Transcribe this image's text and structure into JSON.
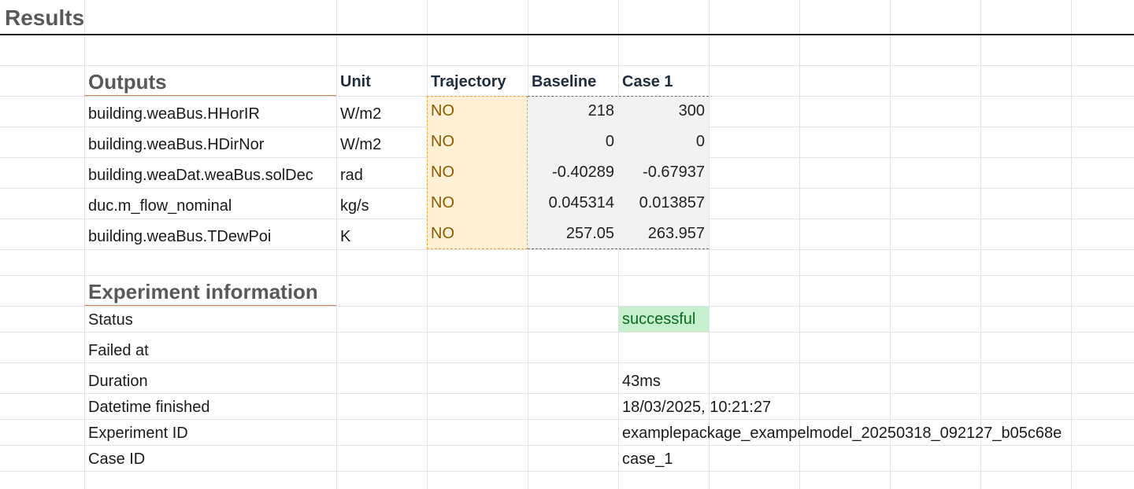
{
  "sheet": {
    "title": "Results"
  },
  "outputs": {
    "section_title": "Outputs",
    "headers": {
      "unit": "Unit",
      "trajectory": "Trajectory",
      "baseline": "Baseline",
      "case1": "Case 1"
    },
    "rows": [
      {
        "name": "building.weaBus.HHorIR",
        "unit": "W/m2",
        "trajectory": "NO",
        "baseline": "218",
        "case1": "300"
      },
      {
        "name": "building.weaBus.HDirNor",
        "unit": "W/m2",
        "trajectory": "NO",
        "baseline": "0",
        "case1": "0"
      },
      {
        "name": "building.weaDat.weaBus.solDec",
        "unit": "rad",
        "trajectory": "NO",
        "baseline": "-0.40289",
        "case1": "-0.67937"
      },
      {
        "name": "duc.m_flow_nominal",
        "unit": "kg/s",
        "trajectory": "NO",
        "baseline": "0.045314",
        "case1": "0.013857"
      },
      {
        "name": "building.weaBus.TDewPoi",
        "unit": "K",
        "trajectory": "NO",
        "baseline": "257.05",
        "case1": "263.957"
      }
    ]
  },
  "experiment": {
    "section_title": "Experiment information",
    "rows": [
      {
        "label": "Status",
        "value": "successful"
      },
      {
        "label": "Failed at",
        "value": ""
      },
      {
        "label": "Duration",
        "value": "43ms"
      },
      {
        "label": "Datetime finished",
        "value": "18/03/2025, 10:21:27"
      },
      {
        "label": "Experiment ID",
        "value": "examplepackage_exampelmodel_20250318_092127_b05c68e"
      },
      {
        "label": "Case ID",
        "value": "case_1"
      }
    ]
  },
  "colors": {
    "trajectory_fill": "#fff0d6",
    "trajectory_border": "#e8a33a",
    "value_fill": "#f2f2f2",
    "status_success_fill": "#c6efce",
    "status_success_text": "#0a6b1f",
    "section_rule": "#c9865a"
  }
}
